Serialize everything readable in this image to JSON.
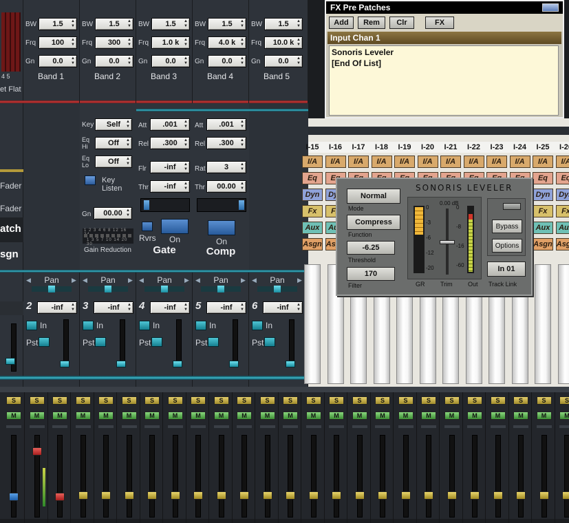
{
  "fx": {
    "title": "FX Pre Patches",
    "buttons": [
      "Add",
      "Rem",
      "Clr",
      "FX"
    ],
    "section": "Input Chan 1",
    "items": [
      "Sonoris Leveler",
      "[End Of List]"
    ]
  },
  "eq": {
    "row_labels": [
      "BW",
      "Frq",
      "Gn"
    ],
    "bands": [
      {
        "label": "Band 1",
        "bw": "1.5",
        "frq": "100",
        "gn": "0.0"
      },
      {
        "label": "Band 2",
        "bw": "1.5",
        "frq": "300",
        "gn": "0.0"
      },
      {
        "label": "Band 3",
        "bw": "1.5",
        "frq": "1.0 k",
        "gn": "0.0"
      },
      {
        "label": "Band 4",
        "bw": "1.5",
        "frq": "4.0 k",
        "gn": "0.0"
      },
      {
        "label": "Band 5",
        "bw": "1.5",
        "frq": "10.0 k",
        "gn": "0.0"
      }
    ],
    "left_numbers": "4 5",
    "left_preset": "et Flat"
  },
  "left_labels": {
    "fader1": "Fader",
    "fader2": "Fader",
    "patch": "atch",
    "asgn": "sgn"
  },
  "key_section": {
    "key_label": "Key",
    "key_value": "Self",
    "eqhi_label1": "Eq",
    "eqhi_label2": "Hi",
    "eqhi_value": "Off",
    "eqlo_label1": "Eq",
    "eqlo_label2": "Lo",
    "eqlo_value": "Off",
    "key_listen": "Key Listen",
    "gn_label": "Gn",
    "gn_value": "00.00",
    "gain_reduction": "Gain Reduction",
    "gr_scale_top": "1 2 3 4 6 8 12 16 24",
    "gr_scale_bottom": "1 3 5 7 10 14 20 30"
  },
  "gate": {
    "att_label": "Att",
    "att_value": ".001",
    "rel_label": "Rel",
    "rel_value": ".300",
    "flr_label": "Flr",
    "flr_value": "-inf",
    "thr_label": "Thr",
    "thr_value": "-inf",
    "rvrs": "Rvrs",
    "on": "On",
    "title": "Gate"
  },
  "comp": {
    "att_label": "Att",
    "att_value": ".001",
    "rel_label": "Rel",
    "rel_value": ".300",
    "rat_label": "Rat",
    "rat_value": "3",
    "thr_label": "Thr",
    "thr_value": "00.00",
    "on": "On",
    "title": "Comp"
  },
  "channels": [
    {
      "num": "2",
      "pan": "Pan",
      "level": "-inf",
      "in": "In",
      "pst": "Pst"
    },
    {
      "num": "3",
      "pan": "Pan",
      "level": "-inf",
      "in": "In",
      "pst": "Pst"
    },
    {
      "num": "4",
      "pan": "Pan",
      "level": "-inf",
      "in": "In",
      "pst": "Pst"
    },
    {
      "num": "5",
      "pan": "Pan",
      "level": "-inf",
      "in": "In",
      "pst": "Pst"
    },
    {
      "num": "6",
      "pan": "Pan",
      "level": "-inf",
      "in": "In",
      "pst": "Pst"
    }
  ],
  "right_channels": [
    "I-15",
    "I-16",
    "I-17",
    "I-18",
    "I-19",
    "I-20",
    "I-21",
    "I-22",
    "I-23",
    "I-24",
    "I-25",
    "I-26"
  ],
  "right_tags": [
    "I/A",
    "Eq",
    "Dyn",
    "Fx",
    "Aux",
    "Asgn"
  ],
  "leveler": {
    "brand": "SONORIS LEVELER",
    "mode_value": "Normal",
    "mode_label": "Mode",
    "function_value": "Compress",
    "function_label": "Function",
    "threshold_value": "-6.25",
    "threshold_label": "Threshold",
    "filter_value": "170",
    "filter_label": "Filter",
    "db_readout": "0.00 dB",
    "scale": [
      "0",
      "-3",
      "-6",
      "-12",
      "-20"
    ],
    "out_scale": [
      "0",
      "-8",
      "-16",
      "-60"
    ],
    "meter_labels": [
      "GR",
      "Trim",
      "Out"
    ],
    "bypass": "Bypass",
    "options": "Options",
    "track_link_value": "In 01",
    "track_link_label": "Track Link"
  },
  "mini_strips": {
    "solo": "S",
    "mute": "M"
  },
  "colors": {
    "tag_ia": "#d8a96b",
    "tag_eq": "#e3a48e",
    "tag_dyn": "#8fa2d8",
    "tag_fx": "#d7c06a",
    "tag_aux": "#6fc0b5",
    "tag_asgn": "#e0a066"
  }
}
